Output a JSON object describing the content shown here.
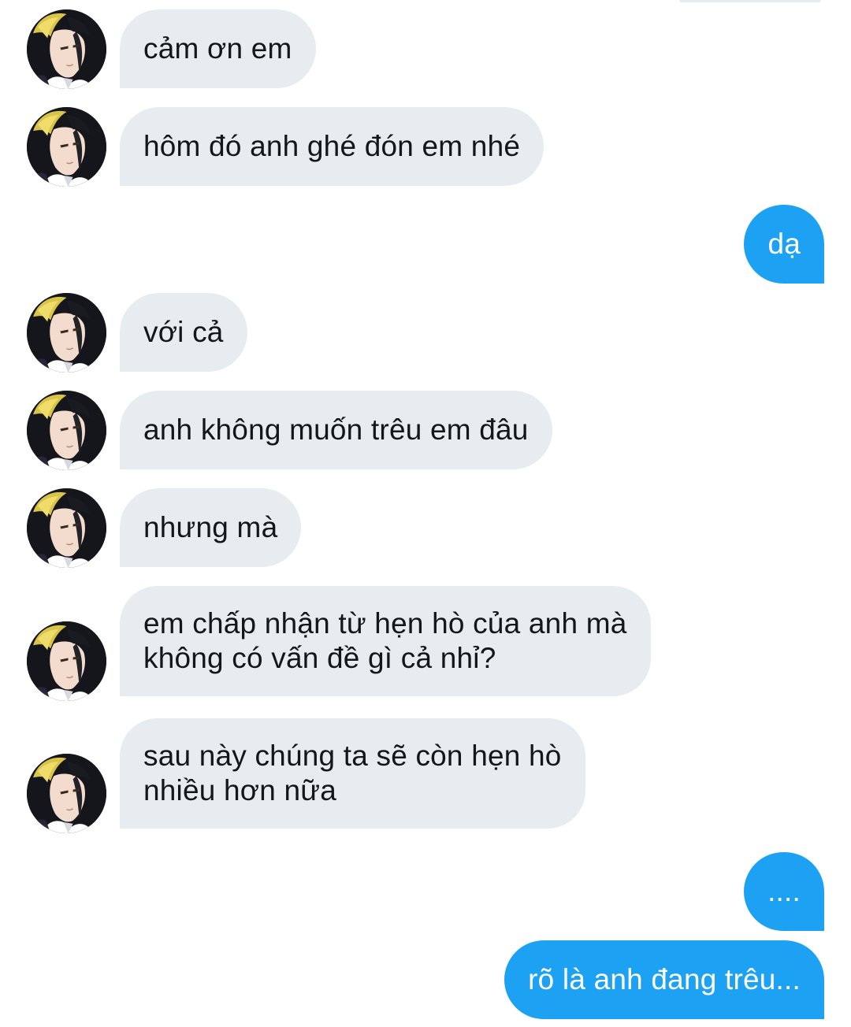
{
  "colors": {
    "incoming_bubble": "#e6ecf0",
    "outgoing_bubble": "#1da1f2",
    "incoming_text": "#14171a",
    "outgoing_text": "#ffffff"
  },
  "avatar_icon": "anime-character-avatar",
  "messages": [
    {
      "direction": "incoming",
      "text": "cảm ơn em"
    },
    {
      "direction": "incoming",
      "text": "hôm đó anh ghé đón em nhé"
    },
    {
      "direction": "outgoing",
      "text": "dạ"
    },
    {
      "direction": "incoming",
      "text": "với cả"
    },
    {
      "direction": "incoming",
      "text": "anh không muốn trêu em đâu"
    },
    {
      "direction": "incoming",
      "text": "nhưng mà"
    },
    {
      "direction": "incoming",
      "lines": [
        "em chấp nhận từ hẹn hò của anh mà",
        "không có vấn đề gì cả nhỉ?"
      ]
    },
    {
      "direction": "incoming",
      "lines": [
        "sau này chúng ta sẽ còn hẹn hò",
        "nhiều hơn nữa"
      ]
    },
    {
      "direction": "outgoing",
      "text": "...."
    },
    {
      "direction": "outgoing",
      "text": "rõ là anh đang trêu..."
    }
  ]
}
